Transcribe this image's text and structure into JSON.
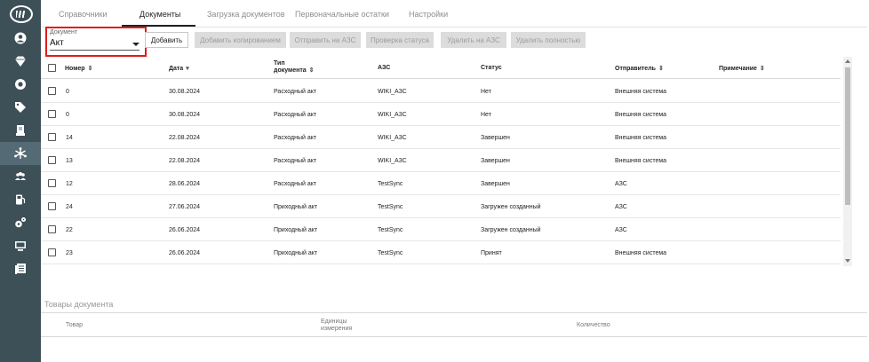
{
  "sidebar": {
    "icons": [
      "logo-icon",
      "user-circle-icon",
      "diamond-icon",
      "lifebuoy-icon",
      "tag-icon",
      "printer-icon",
      "network-icon",
      "users-icon",
      "fuel-pump-icon",
      "gears-icon",
      "monitor-icon",
      "documents-icon"
    ],
    "active_index": 6
  },
  "tabs": [
    {
      "label": "Справочники"
    },
    {
      "label": "Документы"
    },
    {
      "label": "Загрузка документов"
    },
    {
      "label": "Первоначальные остатки"
    },
    {
      "label": "Настройки"
    }
  ],
  "active_tab": 1,
  "document_select": {
    "caption": "Документ",
    "value": "Акт"
  },
  "buttons": {
    "add": "Добавить",
    "add_copy": "Добавить копированием",
    "send": "Отправить на АЗС",
    "check_status": "Проверка статуса",
    "delete_azs": "Удалить на АЗС",
    "delete_full": "Удалить полностью"
  },
  "table": {
    "columns": {
      "number": "Номер",
      "date": "Дата",
      "type_line1": "Тип",
      "type_line2": "документа",
      "azs": "АЗС",
      "status": "Статус",
      "sender": "Отправитель",
      "note": "Примечание"
    },
    "rows": [
      {
        "number": "0",
        "date": "30.08.2024",
        "type": "Расходный акт",
        "azs": "WIKI_A3C",
        "status": "Нет",
        "sender": "Внешняя система",
        "note": ""
      },
      {
        "number": "0",
        "date": "30.08.2024",
        "type": "Расходный акт",
        "azs": "WIKI_A3C",
        "status": "Нет",
        "sender": "Внешняя система",
        "note": ""
      },
      {
        "number": "14",
        "date": "22.08.2024",
        "type": "Расходный акт",
        "azs": "WIKI_A3C",
        "status": "Завершен",
        "sender": "Внешняя система",
        "note": ""
      },
      {
        "number": "13",
        "date": "22.08.2024",
        "type": "Расходный акт",
        "azs": "WIKI_A3C",
        "status": "Завершен",
        "sender": "Внешняя система",
        "note": ""
      },
      {
        "number": "12",
        "date": "28.06.2024",
        "type": "Расходный акт",
        "azs": "TestSync",
        "status": "Завершен",
        "sender": "АЗС",
        "note": ""
      },
      {
        "number": "24",
        "date": "27.06.2024",
        "type": "Приходный акт",
        "azs": "TestSync",
        "status": "Загружен созданный",
        "sender": "АЗС",
        "note": ""
      },
      {
        "number": "22",
        "date": "26.06.2024",
        "type": "Приходный акт",
        "azs": "TestSync",
        "status": "Загружен созданный",
        "sender": "АЗС",
        "note": ""
      },
      {
        "number": "23",
        "date": "26.06.2024",
        "type": "Приходный акт",
        "azs": "TestSync",
        "status": "Принят",
        "sender": "Внешняя система",
        "note": ""
      }
    ]
  },
  "goods": {
    "title": "Товары документа",
    "columns": {
      "product": "Товар",
      "unit_line1": "Единицы",
      "unit_line2": "измерения",
      "quantity": "Количество"
    }
  }
}
